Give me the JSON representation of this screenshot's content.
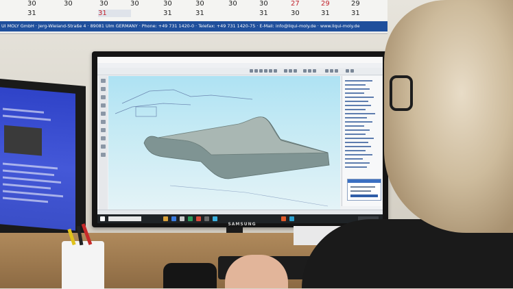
{
  "calendar": {
    "row1": [
      "30",
      "30",
      "30",
      "30",
      "30",
      "30",
      "30",
      "30",
      "27",
      "29",
      "29"
    ],
    "row2": [
      "31",
      "31",
      "31",
      "31",
      "31",
      "30",
      "31",
      "31"
    ],
    "footer": "UI MOLY GmbH · Jerg-Wieland-Straße 4 · 89081 Ulm GERMANY · Phone: +49 731 1420-0 · Telefax: +49 731 1420-75 · E-Mail: info@liqui-moly.de · www.liqui-moly.de"
  },
  "monitor": {
    "brand": "SAMSUNG"
  },
  "scene_colors": {
    "wall": "#e4e1d8",
    "calendar_bar": "#1f4f9c",
    "cad_viewport": "#bde6f3",
    "part_surface": "#7d8f8f",
    "left_screen": "#3b4fd0"
  }
}
